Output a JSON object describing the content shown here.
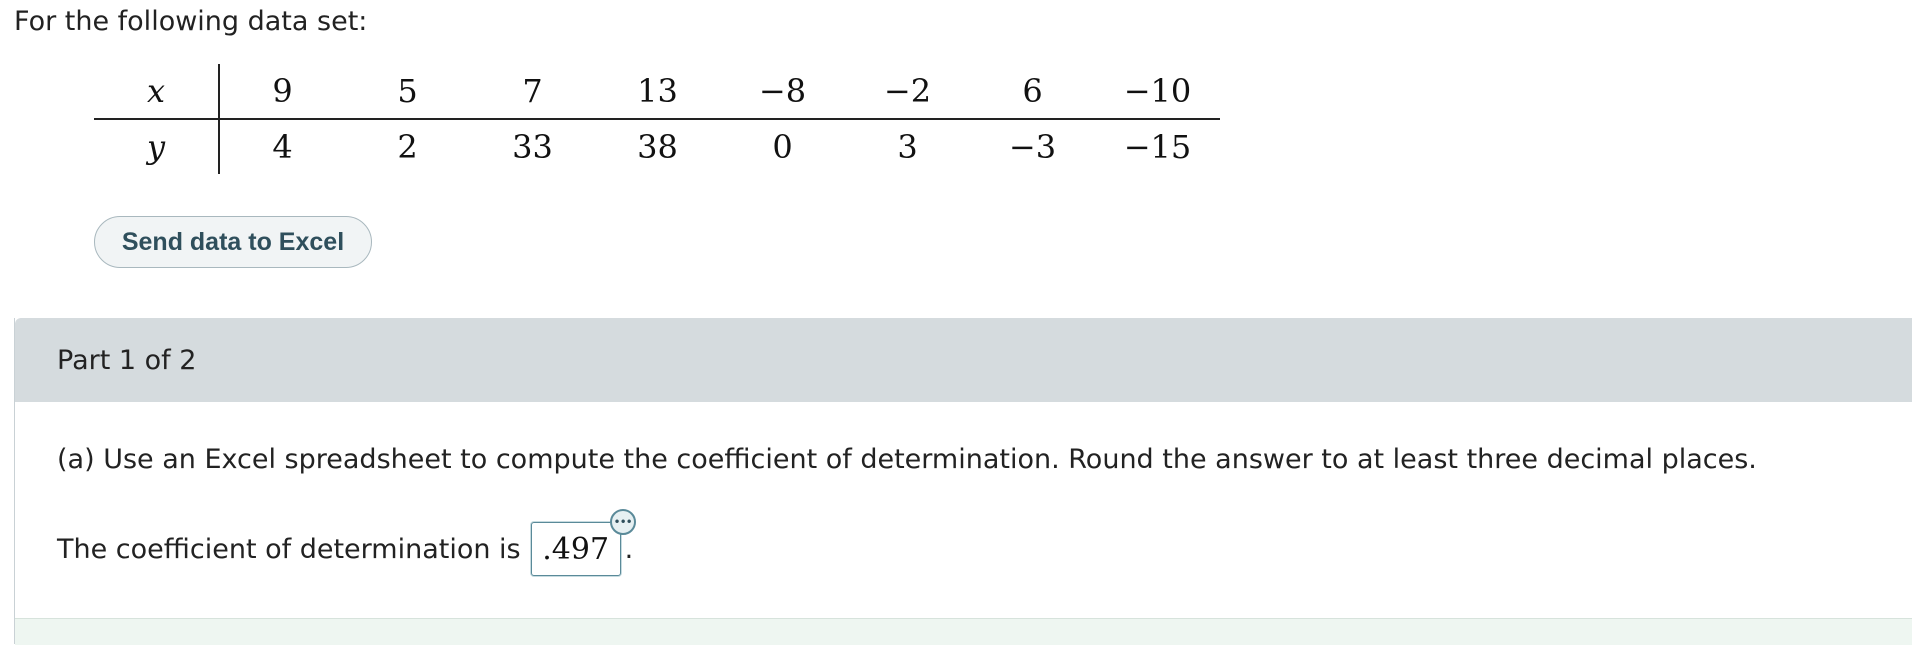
{
  "intro_text": "For the following data set:",
  "data_table": {
    "row_x": {
      "label": "x",
      "values": [
        "9",
        "5",
        "7",
        "13",
        "−8",
        "−2",
        "6",
        "−10"
      ]
    },
    "row_y": {
      "label": "y",
      "values": [
        "4",
        "2",
        "33",
        "38",
        "0",
        "3",
        "−3",
        "−15"
      ]
    }
  },
  "excel_button_label": "Send data to Excel",
  "part": {
    "header": "Part 1 of 2",
    "question": "(a) Use an Excel spreadsheet to compute the coefficient of determination. Round the answer to at least three decimal places.",
    "answer_prefix": "The coefficient of determination is",
    "answer_value": ".497",
    "answer_suffix": ".",
    "more_icon_glyph": "•••"
  }
}
